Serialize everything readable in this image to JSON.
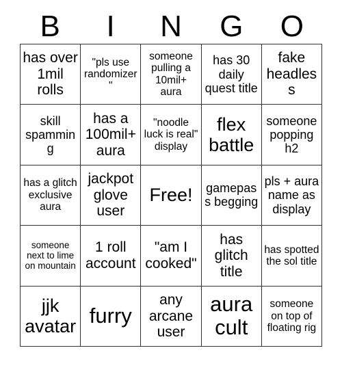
{
  "card": {
    "header_letters": [
      "B",
      "I",
      "N",
      "G",
      "O"
    ],
    "columns": 5,
    "rows": 5,
    "border_color": "#333333",
    "text_color": "#000000",
    "background_color": "#ffffff",
    "cells": [
      {
        "text": "has over 1mil rolls",
        "size": "l",
        "free": false
      },
      {
        "text": "\"pls use randomizer\"",
        "size": "s",
        "free": false
      },
      {
        "text": "someone pulling a 10mil+ aura",
        "size": "s",
        "free": false
      },
      {
        "text": "has 30 daily quest title",
        "size": "m",
        "free": false
      },
      {
        "text": "fake headless",
        "size": "l",
        "free": false
      },
      {
        "text": "skill spamming",
        "size": "m",
        "free": false
      },
      {
        "text": "has a 100mil+ aura",
        "size": "l",
        "free": false
      },
      {
        "text": "\"noodle luck is real\" display",
        "size": "s",
        "free": false
      },
      {
        "text": "flex battle",
        "size": "xl",
        "free": false
      },
      {
        "text": "someone popping h2",
        "size": "m",
        "free": false
      },
      {
        "text": "has a glitch exclusive aura",
        "size": "s",
        "free": false
      },
      {
        "text": "jackpot glove user",
        "size": "l",
        "free": false
      },
      {
        "text": "Free!",
        "size": "xl",
        "free": true
      },
      {
        "text": "gamepass begging",
        "size": "m",
        "free": false
      },
      {
        "text": "pls + aura name as display",
        "size": "m",
        "free": false
      },
      {
        "text": "someone next to lime on mountain",
        "size": "xs",
        "free": false
      },
      {
        "text": "1 roll account",
        "size": "l",
        "free": false
      },
      {
        "text": "\"am I cooked\"",
        "size": "l",
        "free": false
      },
      {
        "text": "has glitch title",
        "size": "l",
        "free": false
      },
      {
        "text": "has spotted the sol title",
        "size": "s",
        "free": false
      },
      {
        "text": "jjk avatar",
        "size": "xl",
        "free": false
      },
      {
        "text": "furry",
        "size": "xxl",
        "free": false
      },
      {
        "text": "any arcane user",
        "size": "l",
        "free": false
      },
      {
        "text": "aura cult",
        "size": "xxl",
        "free": false
      },
      {
        "text": "someone on top of floating rig",
        "size": "s",
        "free": false
      }
    ]
  }
}
